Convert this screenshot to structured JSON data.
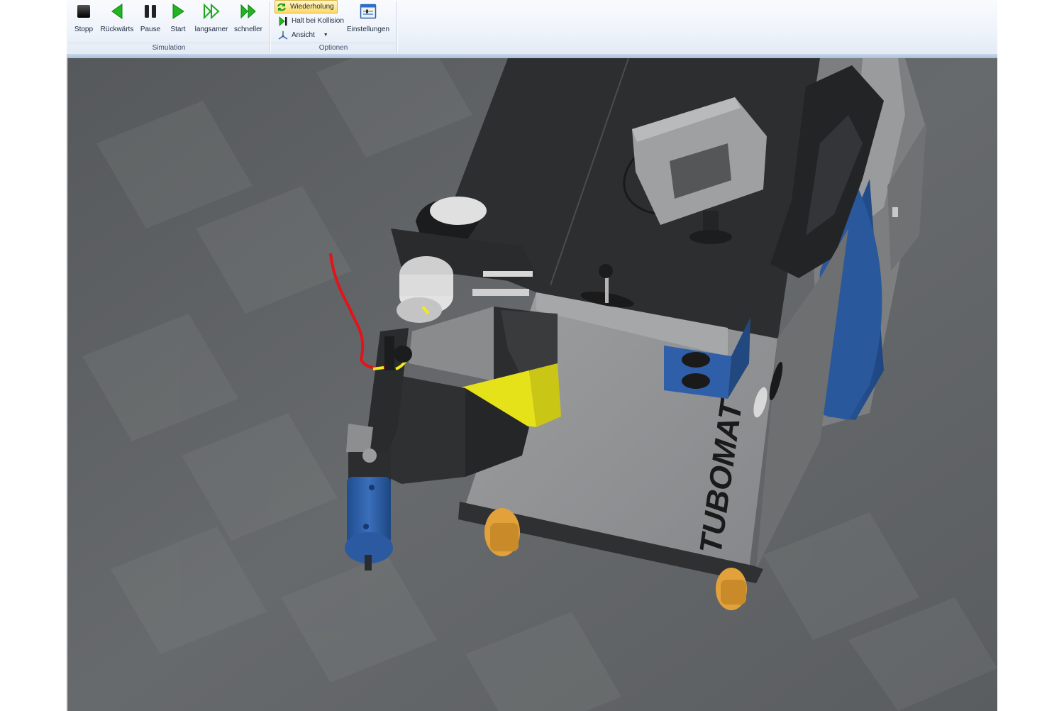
{
  "ribbon": {
    "simulation": {
      "label": "Simulation",
      "buttons": [
        {
          "id": "stop",
          "label": "Stopp",
          "icon": "stop-icon"
        },
        {
          "id": "back",
          "label": "Rückwärts",
          "icon": "play-back-icon"
        },
        {
          "id": "pause",
          "label": "Pause",
          "icon": "pause-icon"
        },
        {
          "id": "start",
          "label": "Start",
          "icon": "play-icon"
        },
        {
          "id": "slower",
          "label": "langsamer",
          "icon": "slower-icon"
        },
        {
          "id": "faster",
          "label": "schneller",
          "icon": "faster-icon"
        }
      ]
    },
    "options": {
      "label": "Optionen",
      "repeat_label": "Wiederholung",
      "halt_label": "Halt bei Kollision",
      "view_label": "Ansicht",
      "settings_label": "Einstellungen"
    }
  },
  "scene": {
    "brand_text": "TUBOMAT"
  },
  "colors": {
    "play_green": "#1fb21f",
    "machine_dark": "#2e2f31",
    "machine_grey": "#8f9092",
    "accent_blue": "#2d5fa6",
    "clamp_yellow": "#e6e21a",
    "wheel_orange": "#d99a2b",
    "tube_red": "#e0141a",
    "floor": "#5e6265"
  }
}
